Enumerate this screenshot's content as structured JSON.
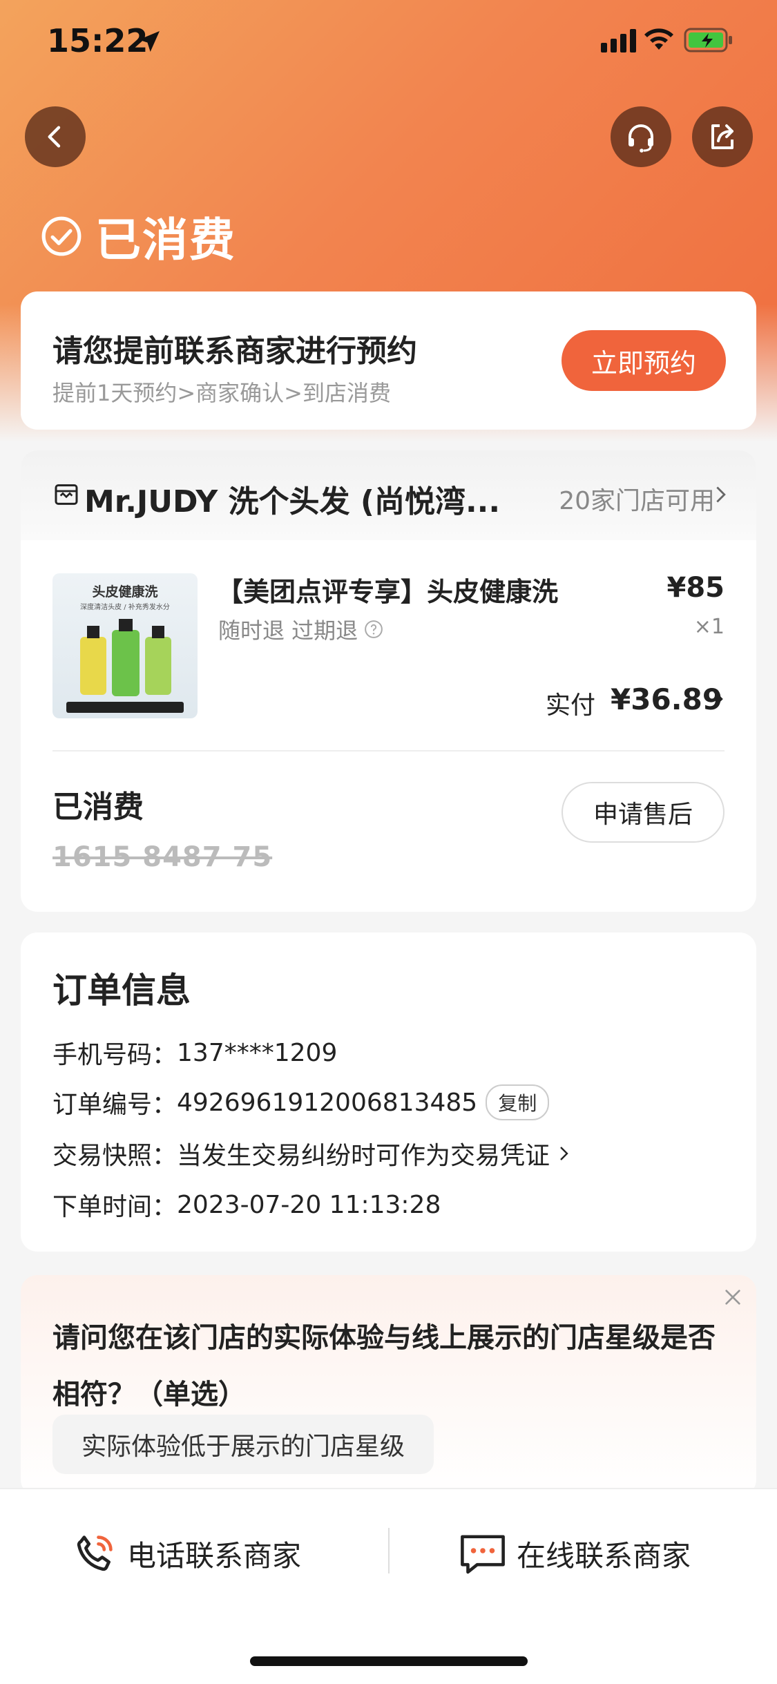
{
  "status_bar": {
    "time": "15:22"
  },
  "header": {
    "status_title": "已消费"
  },
  "booking": {
    "title": "请您提前联系商家进行预约",
    "steps": "提前1天预约>商家确认>到店消费",
    "button": "立即预约"
  },
  "store": {
    "name": "Mr.JUDY 洗个头发 (尚悦湾...",
    "available": "20家门店可用"
  },
  "product": {
    "thumb_title": "头皮健康洗",
    "thumb_sub": "深度清洁头皮 / 补充秀发水分",
    "name": "【美团点评专享】头皮健康洗",
    "price": "¥85",
    "tags": "随时退 过期退",
    "qty": "×1",
    "paid_label": "实付",
    "paid_value": "¥36.89"
  },
  "voucher": {
    "status": "已消费",
    "code": "1615 8487 75",
    "after_sale_button": "申请售后"
  },
  "order": {
    "title": "订单信息",
    "phone_label": "手机号码：",
    "phone": "137****1209",
    "order_no_label": "订单编号：",
    "order_no": "4926961912006813485",
    "copy_button": "复制",
    "snapshot_label": "交易快照：",
    "snapshot_text": "当发生交易纠纷时可作为交易凭证",
    "time_label": "下单时间：",
    "time": "2023-07-20 11:13:28"
  },
  "survey": {
    "question": "请问您在该门店的实际体验与线上展示的门店星级是否相符？（单选）",
    "option1": "实际体验低于展示的门店星级"
  },
  "bottom_bar": {
    "call": "电话联系商家",
    "chat": "在线联系商家"
  },
  "colors": {
    "accent": "#f0643c",
    "header_start": "#f3a35c",
    "header_end": "#ef6d3e"
  }
}
